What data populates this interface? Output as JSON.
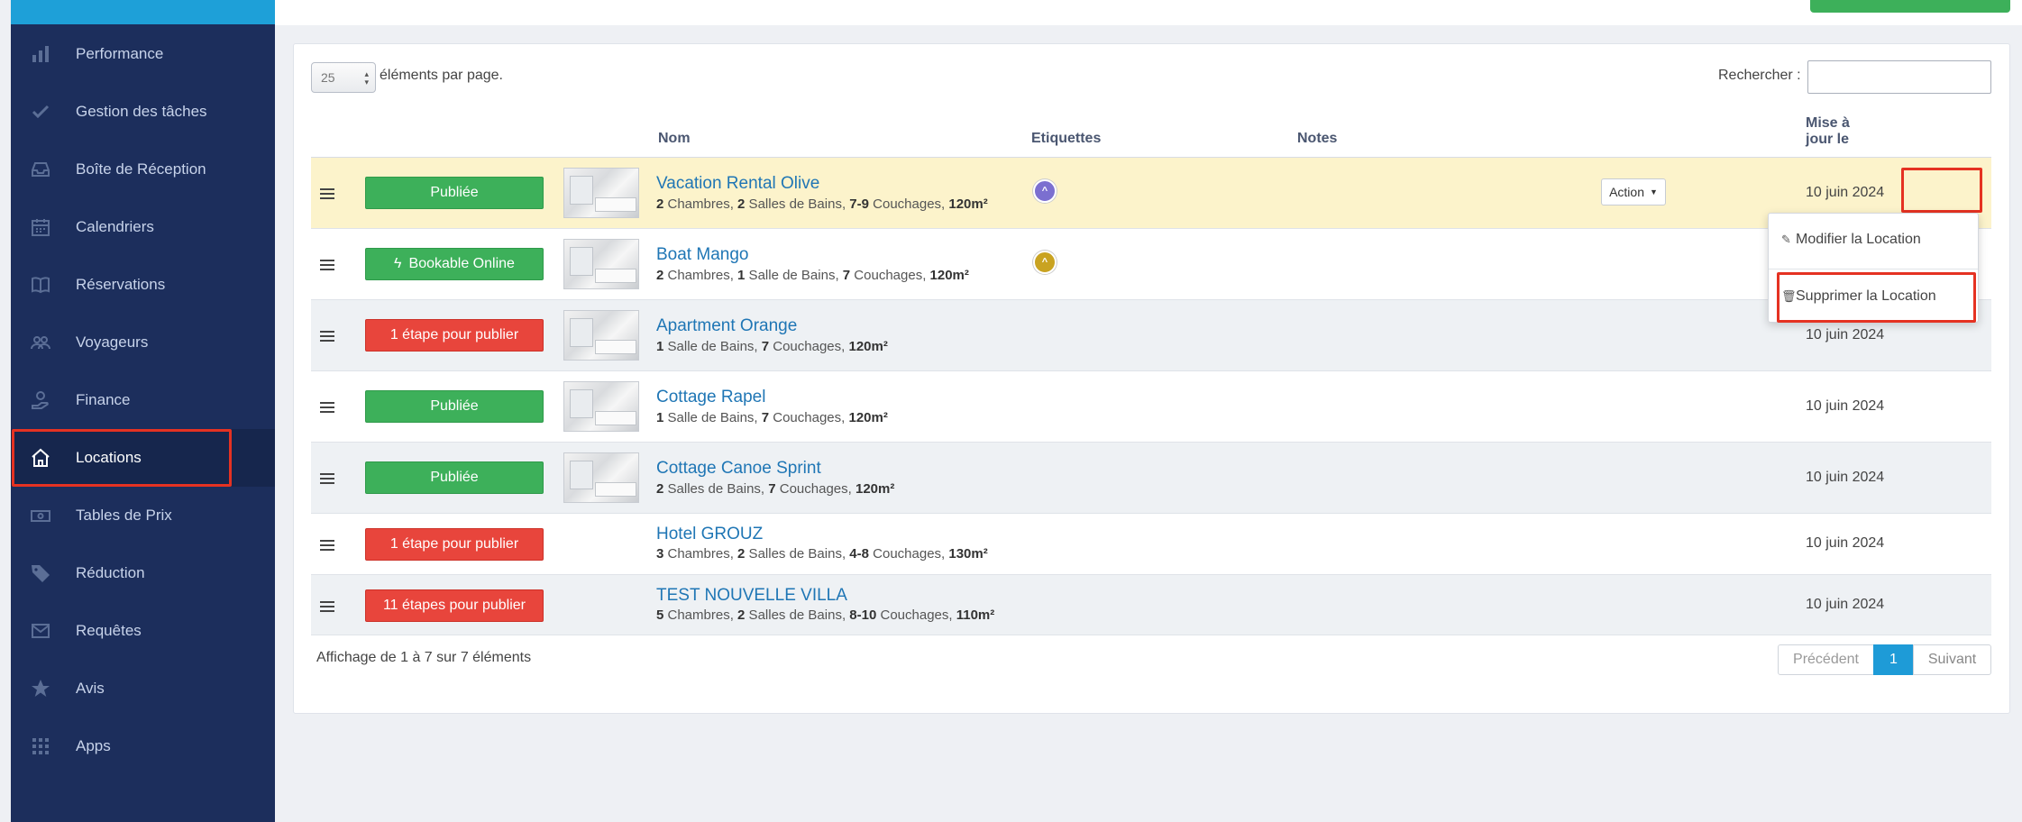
{
  "sidebar": {
    "items": [
      {
        "label": "Performance",
        "icon": "bar-chart-icon"
      },
      {
        "label": "Gestion des tâches",
        "icon": "check-icon"
      },
      {
        "label": "Boîte de Réception",
        "icon": "inbox-icon"
      },
      {
        "label": "Calendriers",
        "icon": "calendar-icon"
      },
      {
        "label": "Réservations",
        "icon": "book-icon"
      },
      {
        "label": "Voyageurs",
        "icon": "users-icon"
      },
      {
        "label": "Finance",
        "icon": "hand-coin-icon"
      },
      {
        "label": "Locations",
        "icon": "home-icon",
        "active": true
      },
      {
        "label": "Tables de Prix",
        "icon": "money-icon"
      },
      {
        "label": "Réduction",
        "icon": "tag-icon"
      },
      {
        "label": "Requêtes",
        "icon": "envelope-icon"
      },
      {
        "label": "Avis",
        "icon": "star-icon"
      },
      {
        "label": "Apps",
        "icon": "grid-icon"
      }
    ]
  },
  "table_controls": {
    "per_page_value": "25",
    "per_page_label": "éléments par page.",
    "search_label": "Rechercher :",
    "search_value": ""
  },
  "columns": {
    "nom": "Nom",
    "etiquettes": "Etiquettes",
    "notes": "Notes",
    "updated_line1": "Mise à",
    "updated_line2": "jour le"
  },
  "rows": [
    {
      "status": "Publiée",
      "status_color": "#3db05a",
      "name": "Vacation Rental Olive",
      "specs": [
        "2",
        " Chambres, ",
        "2",
        " Salles de Bains, ",
        "7-9",
        " Couchages, ",
        "120m²",
        ""
      ],
      "tag_color": "#7b6fd0",
      "date": "10 juin 2024"
    },
    {
      "status": "Bookable Online",
      "status_color": "#3db05a",
      "name": "Boat Mango",
      "specs": [
        "2",
        " Chambres, ",
        "1",
        " Salle de Bains, ",
        "7",
        " Couchages, ",
        "120m²",
        ""
      ],
      "tag_color": "#c9a321",
      "date": "10 juin 2024"
    },
    {
      "status": "1 étape pour publier",
      "status_color": "#e8453c",
      "name": "Apartment Orange",
      "specs": [
        "1",
        " Salle de Bains, ",
        "7",
        " Couchages, ",
        "120m²",
        ""
      ],
      "date": "10 juin 2024"
    },
    {
      "status": "Publiée",
      "status_color": "#3db05a",
      "name": "Cottage Rapel",
      "specs": [
        "1",
        " Salle de Bains, ",
        "7",
        " Couchages, ",
        "120m²",
        ""
      ],
      "date": "10 juin 2024"
    },
    {
      "status": "Publiée",
      "status_color": "#3db05a",
      "name": "Cottage Canoe Sprint",
      "specs": [
        "2",
        " Salles de Bains, ",
        "7",
        " Couchages, ",
        "120m²",
        ""
      ],
      "date": "10 juin 2024"
    },
    {
      "status": "1 étape pour publier",
      "status_color": "#e8453c",
      "name": "Hotel GROUZ",
      "specs": [
        "3",
        " Chambres, ",
        "2",
        " Salles de Bains, ",
        "4-8",
        " Couchages, ",
        "130m²",
        ""
      ],
      "date": "10 juin 2024"
    },
    {
      "status": "11 étapes pour publier",
      "status_color": "#e8453c",
      "name": "TEST NOUVELLE VILLA",
      "specs": [
        "5",
        " Chambres, ",
        "2",
        " Salles de Bains, ",
        "8-10",
        " Couchages, ",
        "110m²",
        ""
      ],
      "date": "10 juin 2024"
    }
  ],
  "action_menu": {
    "button_label": "Action",
    "items": [
      {
        "label": "Modifier la Location",
        "icon": "pencil-icon"
      },
      {
        "label": "Supprimer la Location",
        "icon": "trash-icon"
      }
    ]
  },
  "footer": {
    "info": "Affichage de 1 à 7 sur 7 éléments",
    "prev": "Précédent",
    "page": "1",
    "next": "Suivant"
  },
  "colors": {
    "sidebar_bg": "#1c2e5c",
    "highlight_border": "#e53222",
    "accent": "#1e9bd7"
  }
}
